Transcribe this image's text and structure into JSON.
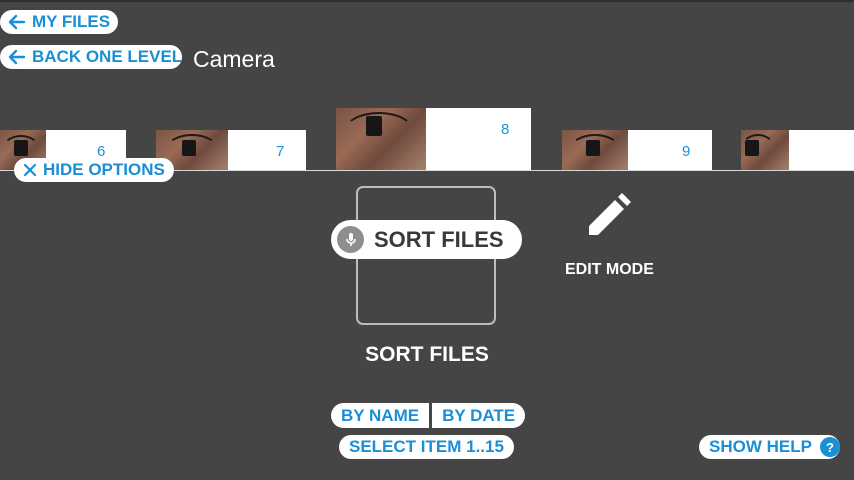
{
  "nav": {
    "my_files": "MY FILES",
    "back_one_level": "BACK ONE LEVEL",
    "folder_title": "Camera"
  },
  "thumbnails": [
    {
      "number": "6"
    },
    {
      "number": "7"
    },
    {
      "number": "8"
    },
    {
      "number": "9"
    },
    {
      "number": ""
    }
  ],
  "options": {
    "hide_options": "HIDE OPTIONS",
    "voice_command": "SORT FILES",
    "sort_files_label": "SORT FILES",
    "edit_mode_label": "EDIT MODE",
    "by_name": "BY NAME",
    "by_date": "BY DATE",
    "select_item": "SELECT ITEM 1..15",
    "show_help": "SHOW HELP",
    "help_badge": "?"
  },
  "colors": {
    "background": "#454545",
    "accent": "#1a8fd6",
    "pill": "#ffffff"
  }
}
